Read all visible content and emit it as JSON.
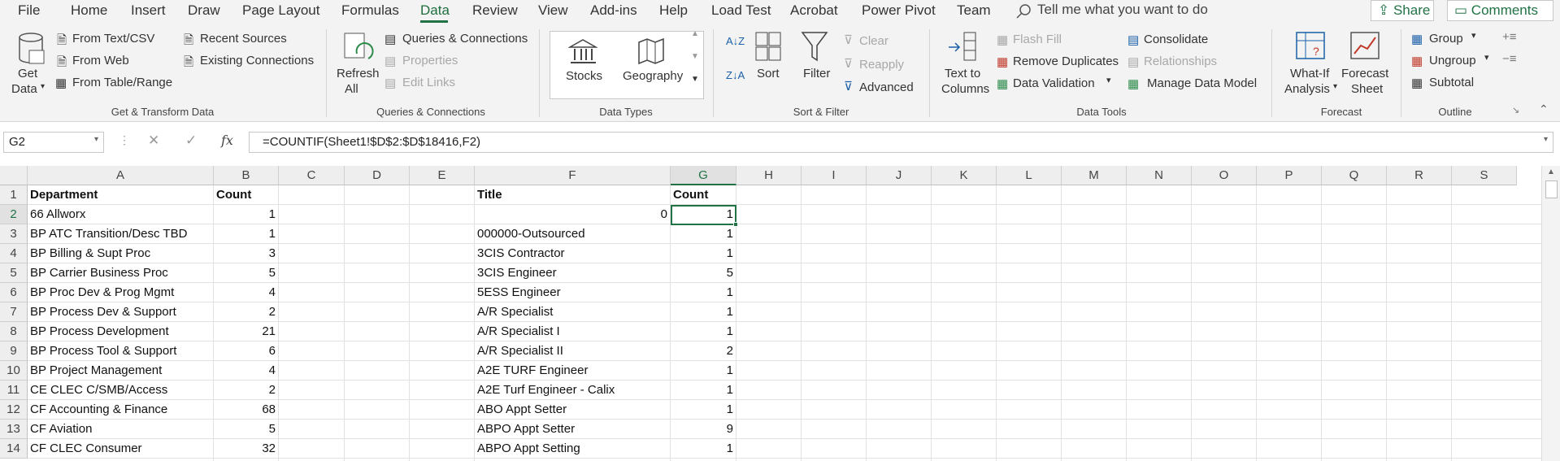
{
  "menu": {
    "file": "File",
    "home": "Home",
    "insert": "Insert",
    "draw": "Draw",
    "page_layout": "Page Layout",
    "formulas": "Formulas",
    "data": "Data",
    "review": "Review",
    "view": "View",
    "addins": "Add-ins",
    "help": "Help",
    "load_test": "Load Test",
    "acrobat": "Acrobat",
    "power_pivot": "Power Pivot",
    "team": "Team",
    "tell_me": "Tell me what you want to do",
    "share": "Share",
    "comments": "Comments"
  },
  "ribbon": {
    "get_data_1": "Get",
    "get_data_2": "Data",
    "from_text_csv": "From Text/CSV",
    "from_web": "From Web",
    "from_table_range": "From Table/Range",
    "recent_sources": "Recent Sources",
    "existing_connections": "Existing Connections",
    "group_get_transform": "Get & Transform Data",
    "refresh_1": "Refresh",
    "refresh_2": "All",
    "queries_connections": "Queries & Connections",
    "properties": "Properties",
    "edit_links": "Edit Links",
    "group_queries": "Queries & Connections",
    "stocks": "Stocks",
    "geography": "Geography",
    "group_data_types": "Data Types",
    "sort": "Sort",
    "filter": "Filter",
    "clear": "Clear",
    "reapply": "Reapply",
    "advanced": "Advanced",
    "group_sort_filter": "Sort & Filter",
    "text_to_columns_1": "Text to",
    "text_to_columns_2": "Columns",
    "flash_fill": "Flash Fill",
    "remove_duplicates": "Remove Duplicates",
    "data_validation": "Data Validation",
    "consolidate": "Consolidate",
    "relationships": "Relationships",
    "manage_data_model": "Manage Data Model",
    "group_data_tools": "Data Tools",
    "what_if_1": "What-If",
    "what_if_2": "Analysis",
    "forecast_sheet_1": "Forecast",
    "forecast_sheet_2": "Sheet",
    "group_forecast": "Forecast",
    "group_btn": "Group",
    "ungroup": "Ungroup",
    "subtotal": "Subtotal",
    "group_outline": "Outline"
  },
  "formula_bar": {
    "name_box": "G2",
    "fx": "fx",
    "formula": "=COUNTIF(Sheet1!$D$2:$D$18416,F2)"
  },
  "sheet": {
    "columns": [
      "A",
      "B",
      "C",
      "D",
      "E",
      "F",
      "G",
      "H",
      "I",
      "J",
      "K",
      "L",
      "M",
      "N",
      "O",
      "P",
      "Q",
      "R",
      "S"
    ],
    "selected_column": "G",
    "selected_row": "2",
    "rows": [
      {
        "n": "1",
        "a": "Department",
        "b": "",
        "f": "Title",
        "g": "Count"
      },
      {
        "n": "2",
        "a": "66 Allworx",
        "b": "1",
        "f": "0",
        "g": "1"
      },
      {
        "n": "3",
        "a": "BP ATC Transition/Desc TBD",
        "b": "1",
        "f": "000000-Outsourced",
        "g": "1"
      },
      {
        "n": "4",
        "a": "BP Billing & Supt Proc",
        "b": "3",
        "f": "3CIS Contractor",
        "g": "1"
      },
      {
        "n": "5",
        "a": "BP Carrier Business Proc",
        "b": "5",
        "f": "3CIS Engineer",
        "g": "5"
      },
      {
        "n": "6",
        "a": "BP Proc Dev & Prog Mgmt",
        "b": "4",
        "f": "5ESS Engineer",
        "g": "1"
      },
      {
        "n": "7",
        "a": "BP Process Dev & Support",
        "b": "2",
        "f": "A/R Specialist",
        "g": "1"
      },
      {
        "n": "8",
        "a": "BP Process Development",
        "b": "21",
        "f": "A/R Specialist I",
        "g": "1"
      },
      {
        "n": "9",
        "a": "BP Process Tool & Support",
        "b": "6",
        "f": "A/R Specialist II",
        "g": "2"
      },
      {
        "n": "10",
        "a": "BP Project Management",
        "b": "4",
        "f": "A2E TURF Engineer",
        "g": "1"
      },
      {
        "n": "11",
        "a": "CE CLEC C/SMB/Access",
        "b": "2",
        "f": "A2E Turf Engineer - Calix",
        "g": "1"
      },
      {
        "n": "12",
        "a": "CF Accounting & Finance",
        "b": "68",
        "f": "ABO Appt Setter",
        "g": "1"
      },
      {
        "n": "13",
        "a": "CF Aviation",
        "b": "5",
        "f": "ABPO Appt Setter",
        "g": "9"
      },
      {
        "n": "14",
        "a": "CF CLEC Consumer",
        "b": "32",
        "f": "ABPO Appt Setting",
        "g": "1"
      }
    ],
    "header_b": "Count"
  },
  "colors": {
    "accent": "#217346",
    "ribbon_bg": "#f3f3f3",
    "header_bg": "#eeeeee"
  }
}
